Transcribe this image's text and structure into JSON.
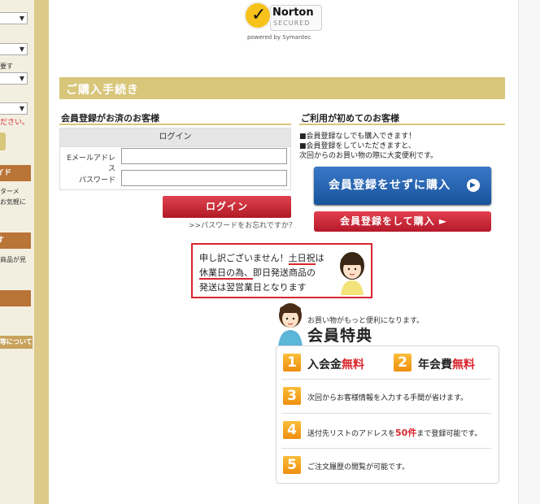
{
  "sidebar": {
    "fragment1": "要す",
    "fragment2": "ださい。",
    "guide_button": "イド",
    "guide_text1": "ターメ",
    "guide_text2": "お気軽に",
    "btn2": "す",
    "btn2_text": "商品が見",
    "btn4": "等について"
  },
  "norton": {
    "name": "Norton",
    "secured": "SECURED",
    "powered": "powered by Symantec"
  },
  "header": {
    "title": "ご購入手続き"
  },
  "member": {
    "title": "会員登録がお済のお客様",
    "login_header": "ログイン",
    "email_label": "Eメールアドレス",
    "password_label": "パスワード",
    "email_value": "",
    "password_value": "",
    "login_button": "ログイン",
    "forgot_link": ">>パスワードをお忘れですか？"
  },
  "first_time": {
    "title": "ご利用が初めてのお客様",
    "line1": "■会員登録なしでも購入できます！",
    "line2": "■会員登録をしていただきますと、",
    "line3": "次回からのお買い物の際に大変便利です。",
    "buy_without_button": "会員登録をせずに購入",
    "buy_with_button": "会員登録をして購入 ►"
  },
  "notice": {
    "line1_a": "申し訳ございません！",
    "line1_b": "土日祝",
    "line1_c": "は",
    "line2_a": "休業日の為、",
    "line2_b": "即日発送商品の",
    "line3": "発送は翌営業日となります"
  },
  "benefits": {
    "subtitle": "お買い物がもっと便利になります。",
    "title": "会員特典",
    "n1": "1",
    "b1a": "入会金",
    "b1b": "無料",
    "n2": "2",
    "b2a": "年会費",
    "b2b": "無料",
    "n3": "3",
    "b3": "次回からお客様情報を入力する手間が省けます。",
    "n4": "4",
    "b4a": "送付先リストのアドレスを",
    "b4b": "50件",
    "b4c": "まで登録可能です。",
    "n5": "5",
    "b5": "ご注文履歴の閲覧が可能です。"
  },
  "colors": {
    "gold": "#d8c67a",
    "accent_red": "#d9262e",
    "blue_button": "#1c58a2",
    "sidebar_brown": "#b97437",
    "orange_number": "#f39a12"
  }
}
